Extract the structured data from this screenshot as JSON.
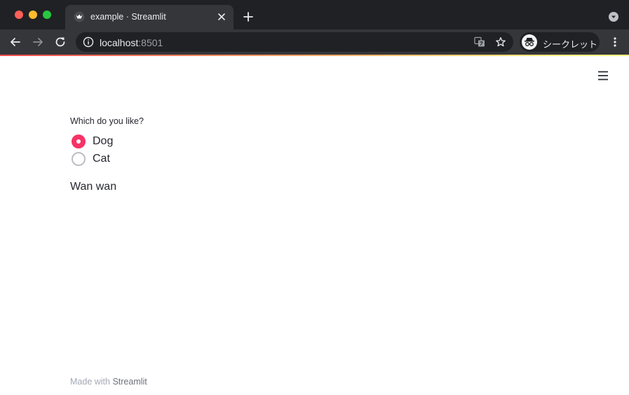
{
  "browser": {
    "tab_title": "example · Streamlit",
    "url_host": "localhost",
    "url_port": ":8501",
    "incognito_label": "シークレット"
  },
  "app": {
    "question": "Which do you like?",
    "options": [
      {
        "label": "Dog",
        "selected": true
      },
      {
        "label": "Cat",
        "selected": false
      }
    ],
    "output": "Wan wan",
    "footer_prefix": "Made with ",
    "footer_link": "Streamlit"
  },
  "colors": {
    "accent": "#f63366",
    "chrome_bg": "#202124",
    "chrome_toolbar": "#35363a"
  },
  "icons": [
    "streamlit-crown-icon",
    "tab-close-icon",
    "new-tab-icon",
    "tab-search-icon",
    "back-icon",
    "forward-icon",
    "reload-icon",
    "info-icon",
    "translate-icon",
    "star-icon",
    "incognito-icon",
    "kebab-menu-icon",
    "hamburger-icon"
  ]
}
